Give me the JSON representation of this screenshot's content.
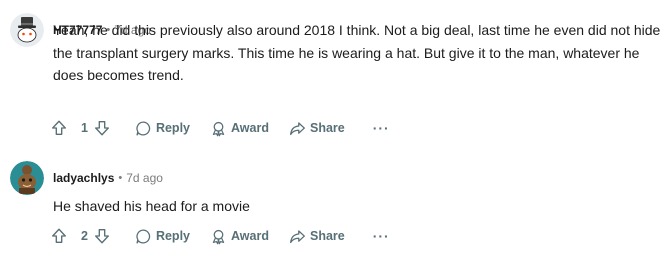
{
  "comments": [
    {
      "author": "HT77777",
      "separator": "•",
      "time": "7d ago",
      "body": "Yeah, he did this previously also around 2018 I think. Not a big deal, last time he even did not hide the transplant surgery marks. This time he is wearing a hat. But give it to the man, whatever he does becomes trend.",
      "votes": "1",
      "reply_label": "Reply",
      "award_label": "Award",
      "share_label": "Share",
      "more_label": "···",
      "avatar_icon": "snoo-top-hat-avatar",
      "avatar_bg": "#e9ecef"
    },
    {
      "author": "ladyachlys",
      "separator": "•",
      "time": "7d ago",
      "body": "He shaved his head for a movie",
      "votes": "2",
      "reply_label": "Reply",
      "award_label": "Award",
      "share_label": "Share",
      "more_label": "···",
      "avatar_icon": "snoo-costume-avatar",
      "avatar_bg": "#2a8e94"
    }
  ],
  "colors": {
    "action_text": "#576f76",
    "meta_text": "#7c7c7c",
    "body_text": "#1c1c1c"
  }
}
